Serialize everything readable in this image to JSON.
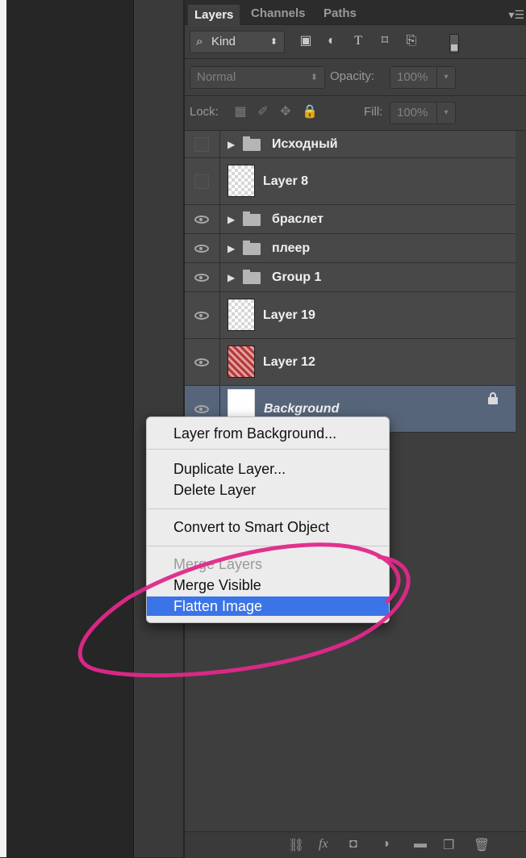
{
  "panel": {
    "tabs": [
      {
        "label": "Layers",
        "active": true
      },
      {
        "label": "Channels",
        "active": false
      },
      {
        "label": "Paths",
        "active": false
      }
    ],
    "filter": {
      "label": "Kind"
    },
    "blend_mode": {
      "value": "Normal"
    },
    "opacity": {
      "label": "Opacity:",
      "value": "100%"
    },
    "lock": {
      "label": "Lock:"
    },
    "fill": {
      "label": "Fill:",
      "value": "100%"
    }
  },
  "layers": [
    {
      "name": "Исходный",
      "type": "group",
      "visible": false
    },
    {
      "name": "Layer 8",
      "type": "layer",
      "visible": false
    },
    {
      "name": "браслет",
      "type": "group",
      "visible": true
    },
    {
      "name": "плеер",
      "type": "group",
      "visible": true
    },
    {
      "name": "Group 1",
      "type": "group",
      "visible": true
    },
    {
      "name": "Layer 19",
      "type": "layer",
      "visible": true
    },
    {
      "name": "Layer 12",
      "type": "layer",
      "visible": true
    },
    {
      "name": "Background",
      "type": "background",
      "visible": true,
      "locked": true,
      "selected": true
    }
  ],
  "context_menu": {
    "items": [
      {
        "label": "Layer from Background...",
        "enabled": true
      },
      {
        "label": "Duplicate Layer...",
        "enabled": true
      },
      {
        "label": "Delete Layer",
        "enabled": true
      },
      {
        "label": "Convert to Smart Object",
        "enabled": true
      },
      {
        "label": "Merge Layers",
        "enabled": false
      },
      {
        "label": "Merge Visible",
        "enabled": true
      },
      {
        "label": "Flatten Image",
        "enabled": true,
        "highlighted": true
      }
    ]
  },
  "colors": {
    "highlight": "#3b74e6",
    "annotation": "#e0288a",
    "selected_layer": "#57657a"
  }
}
